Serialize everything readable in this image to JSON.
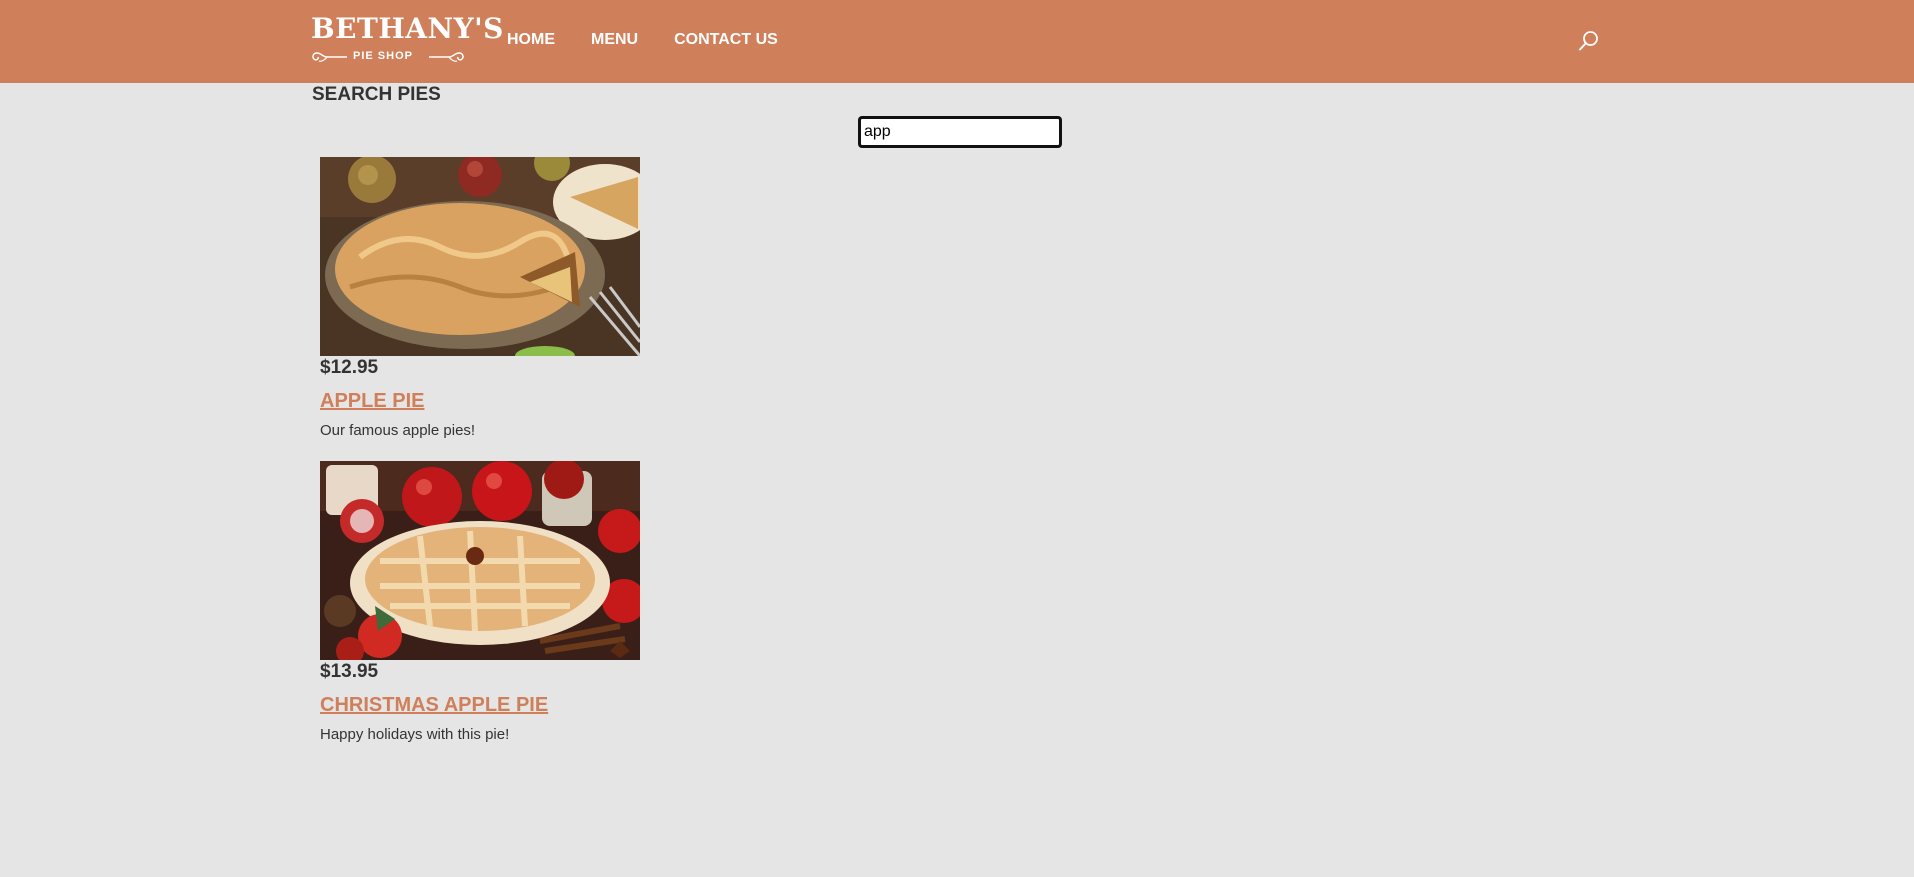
{
  "header": {
    "logo_main": "BETHANY'S",
    "logo_sub": "PIE SHOP",
    "nav": [
      {
        "label": "HOME"
      },
      {
        "label": "MENU"
      },
      {
        "label": "CONTACT US"
      }
    ],
    "search_icon": "search-icon"
  },
  "main": {
    "title": "SEARCH PIES",
    "search": {
      "value": "app",
      "placeholder": ""
    },
    "results": [
      {
        "price": "$12.95",
        "name": "APPLE PIE",
        "description": "Our famous apple pies!",
        "image_alt": "Apple pie"
      },
      {
        "price": "$13.95",
        "name": "CHRISTMAS APPLE PIE",
        "description": "Happy holidays with this pie!",
        "image_alt": "Christmas apple pie"
      }
    ]
  },
  "colors": {
    "brand": "#cf7f59",
    "background": "#e5e5e5",
    "text": "#333333"
  }
}
